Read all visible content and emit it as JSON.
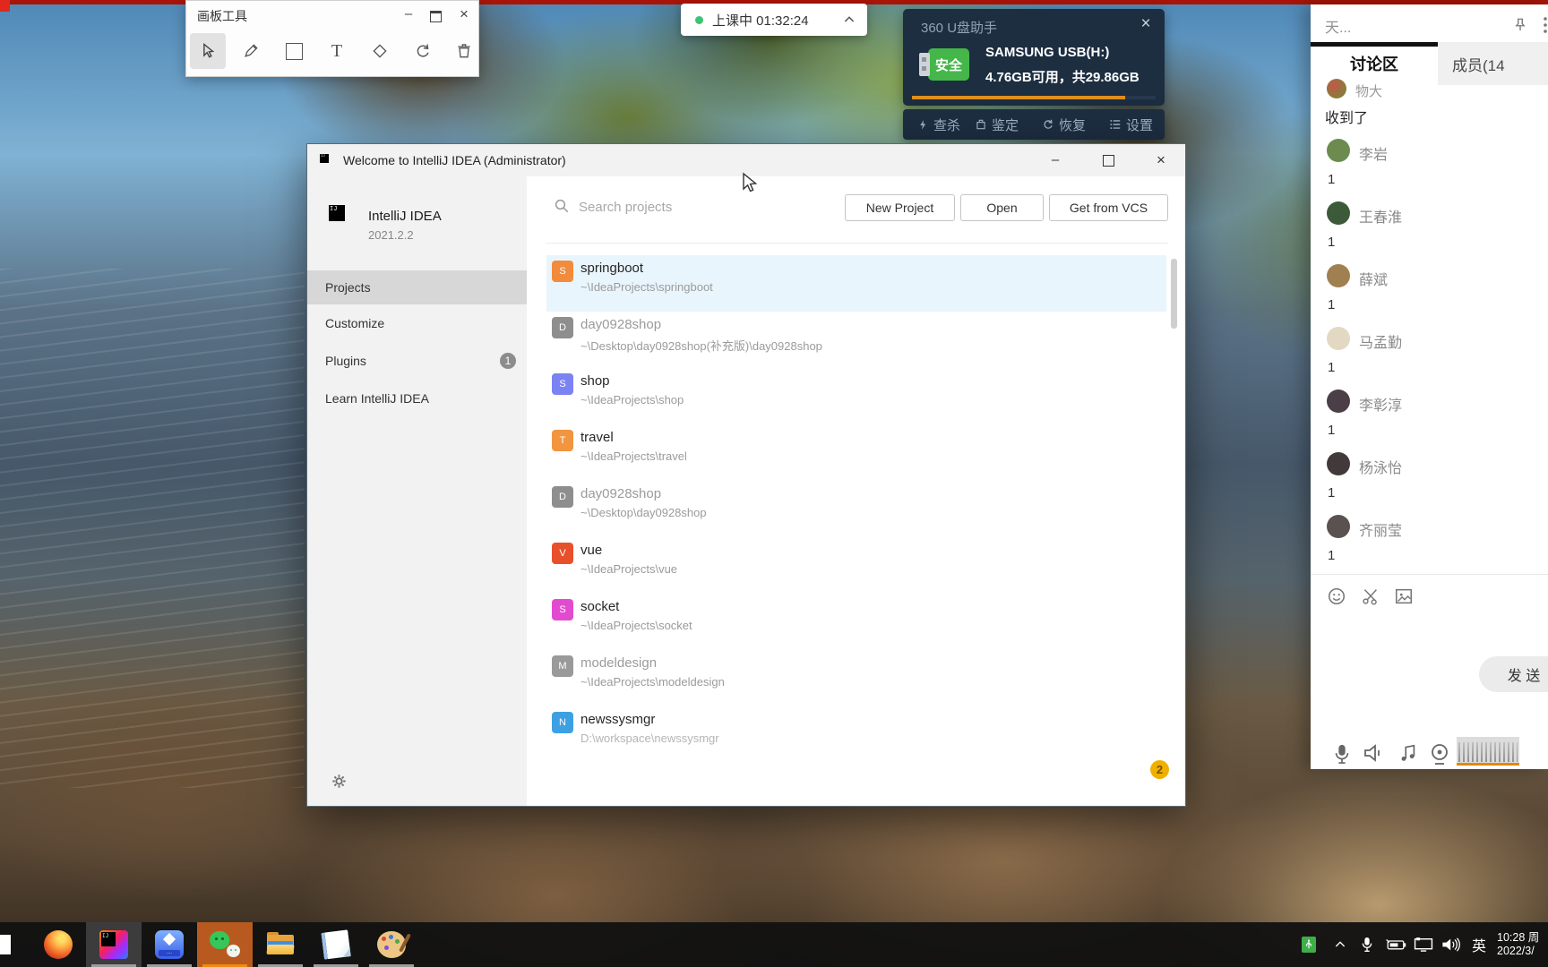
{
  "screen": {
    "red_strip_color": "#a81407"
  },
  "paint_panel": {
    "title": "画板工具",
    "tools": [
      "select",
      "pen",
      "rectangle",
      "text",
      "eraser",
      "undo",
      "delete"
    ]
  },
  "class_pill": {
    "label": "上课中 01:32:24"
  },
  "usb_helper": {
    "title": "360 U盘助手",
    "safe_badge": "安全",
    "safe_color": "#45b649",
    "drive_name": "SAMSUNG USB(H:)",
    "capacity": "4.76GB可用，共29.86GB",
    "panel_color": "#1d2e41",
    "progress_color": "#de8f1d",
    "actions": [
      {
        "label": "查杀"
      },
      {
        "label": "鉴定"
      },
      {
        "label": "恢复"
      },
      {
        "label": "设置"
      }
    ]
  },
  "idea": {
    "window_title": "Welcome to IntelliJ IDEA (Administrator)",
    "product": "IntelliJ IDEA",
    "version": "2021.2.2",
    "nav": [
      {
        "label": "Projects"
      },
      {
        "label": "Customize"
      },
      {
        "label": "Plugins",
        "badge": "1"
      },
      {
        "label": "Learn IntelliJ IDEA"
      }
    ],
    "search_placeholder": "Search projects",
    "buttons": {
      "new_project": "New Project",
      "open": "Open",
      "get_from_vcs": "Get from VCS"
    },
    "selected_row_color": "#e9f5fd",
    "projects": [
      {
        "letter": "S",
        "name": "springboot",
        "path": "~\\IdeaProjects\\springboot",
        "icon_color": "#f28b3b"
      },
      {
        "letter": "D",
        "name": "day0928shop",
        "path": "~\\Desktop\\day0928shop(补充版)\\day0928shop",
        "icon_color": "#8e8e8e"
      },
      {
        "letter": "S",
        "name": "shop",
        "path": "~\\IdeaProjects\\shop",
        "icon_color": "#7b82f2"
      },
      {
        "letter": "T",
        "name": "travel",
        "path": "~\\IdeaProjects\\travel",
        "icon_color": "#f2953f"
      },
      {
        "letter": "D",
        "name": "day0928shop",
        "path": "~\\Desktop\\day0928shop",
        "icon_color": "#8e8e8e"
      },
      {
        "letter": "V",
        "name": "vue",
        "path": "~\\IdeaProjects\\vue",
        "icon_color": "#e8502c"
      },
      {
        "letter": "S",
        "name": "socket",
        "path": "~\\IdeaProjects\\socket",
        "icon_color": "#e24bd0"
      },
      {
        "letter": "M",
        "name": "modeldesign",
        "path": "~\\IdeaProjects\\modeldesign",
        "icon_color": "#9a9a9a"
      },
      {
        "letter": "N",
        "name": "newssysmgr",
        "path": "D:\\workspace\\newssysmgr",
        "icon_color": "#3da0e3"
      }
    ],
    "notification_badge": "2"
  },
  "chat": {
    "window_title": "天...",
    "tabs": {
      "discussion": "讨论区",
      "members": "成员(14"
    },
    "first_message": {
      "sender": "物大",
      "text": "收到了"
    },
    "members": [
      {
        "name": "李岩",
        "count": "1",
        "avatar": "#6b8c4e"
      },
      {
        "name": "王春淮",
        "count": "1",
        "avatar": "#3c5a3a"
      },
      {
        "name": "薛斌",
        "count": "1",
        "avatar": "#a08050"
      },
      {
        "name": "马孟勤",
        "count": "1",
        "avatar": "#e3d9c2"
      },
      {
        "name": "李彰淳",
        "count": "1",
        "avatar": "#4a3f46"
      },
      {
        "name": "杨泳怡",
        "count": "1",
        "avatar": "#423a3a"
      },
      {
        "name": "齐丽莹",
        "count": "1",
        "avatar": "#5a5250"
      }
    ],
    "send_label": "发 送"
  },
  "taskbar": {
    "apps": [
      "start",
      "firefox",
      "intellij-idea",
      "class-app",
      "wechat",
      "file-explorer",
      "notepad",
      "paint"
    ],
    "tray": {
      "ime": "英",
      "time": "10:28 周",
      "date": "2022/3/"
    }
  }
}
